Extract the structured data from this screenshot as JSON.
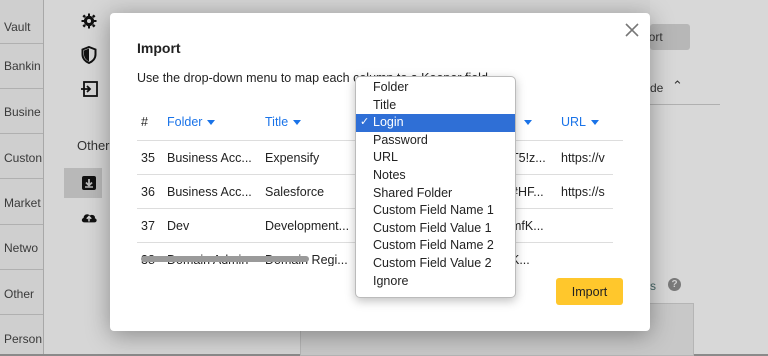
{
  "background": {
    "rail_items": [
      "Vault",
      "Bankin",
      "Busine",
      "Custon",
      "Market",
      "Netwo",
      "Other",
      "Person"
    ],
    "side_other_label": "Other",
    "import_button_label": "port",
    "de_text": "de",
    "s_text": "s"
  },
  "modal": {
    "title": "Import",
    "instructions": "Use the drop-down menu to map each column to a Keeper field",
    "columns": {
      "hash": "#",
      "folder": "Folder",
      "title": "Title",
      "login": "",
      "url": "URL"
    },
    "rows": [
      {
        "num": "35",
        "folder": "Business Acc...",
        "title": "Expensify",
        "login_tail": "T5!z...",
        "url": "https://v"
      },
      {
        "num": "36",
        "folder": "Business Acc...",
        "title": "Salesforce",
        "login_tail": "#HF...",
        "url": "https://s"
      },
      {
        "num": "37",
        "folder": "Dev",
        "title": "Development...",
        "login_tail": "mfK...",
        "url": ""
      },
      {
        "num": "38",
        "folder": "Domain Admin",
        "title": "Domain Regi...",
        "login_tail": "K...",
        "url": ""
      }
    ],
    "import_button": "Import"
  },
  "dropdown": {
    "options": [
      "Folder",
      "Title",
      "Login",
      "Password",
      "URL",
      "Notes",
      "Shared Folder",
      "Custom Field Name 1",
      "Custom Field Value 1",
      "Custom Field Name 2",
      "Custom Field Value 2",
      "Ignore"
    ],
    "selected": "Login",
    "check": "✓"
  },
  "colors": {
    "accent": "#1a73e8",
    "selection": "#2f6fd6",
    "import_button": "#ffc72c"
  }
}
